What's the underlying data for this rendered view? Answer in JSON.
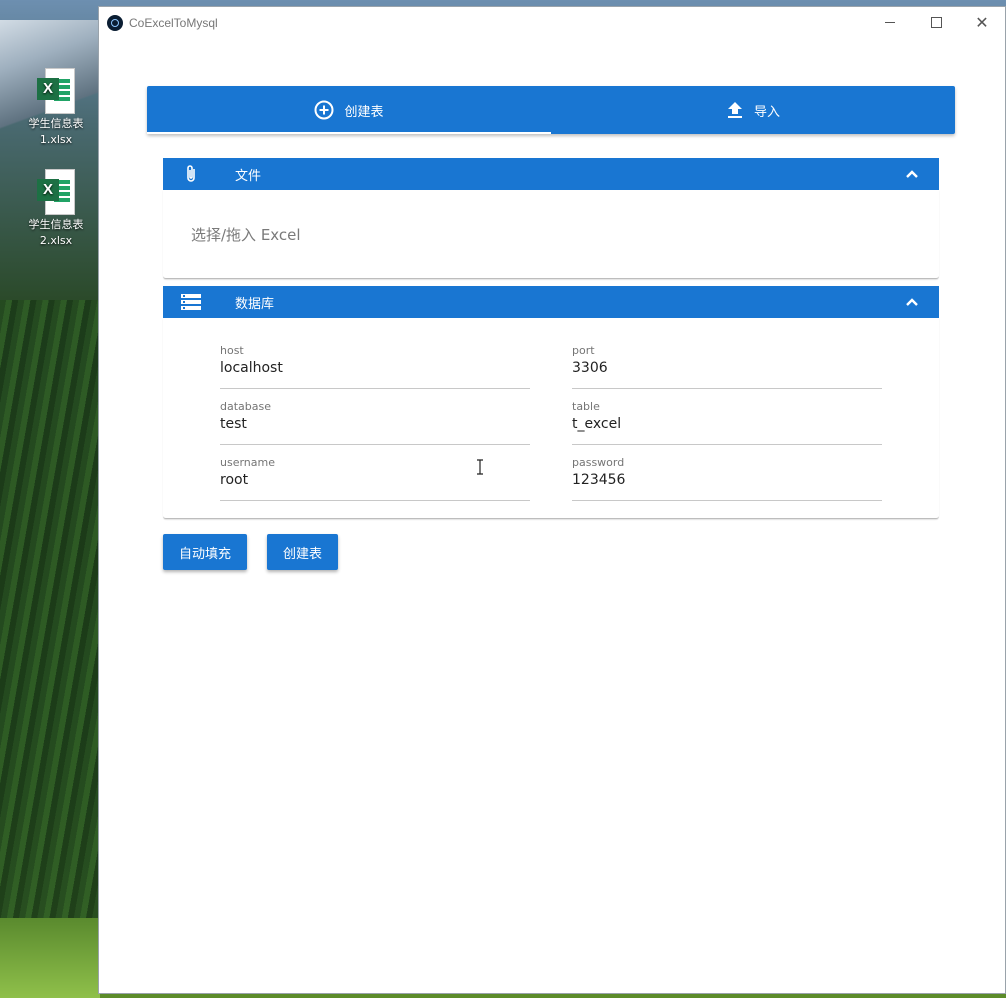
{
  "desktop": {
    "icons": [
      {
        "name": "学生信息表1.xlsx",
        "line1": "学生信息表",
        "line2": "1.xlsx"
      },
      {
        "name": "学生信息表2.xlsx",
        "line1": "学生信息表",
        "line2": "2.xlsx"
      }
    ],
    "excel_badge": "X"
  },
  "window": {
    "title": "CoExcelToMysql",
    "controls": {
      "minimize": "minimize",
      "maximize": "maximize",
      "close": "✕"
    }
  },
  "tabs": [
    {
      "label": "创建表",
      "icon": "add-circle-icon",
      "active": true
    },
    {
      "label": "导入",
      "icon": "upload-icon",
      "active": false
    }
  ],
  "file_panel": {
    "title": "文件",
    "icon": "paperclip-icon",
    "dropzone": "选择/拖入 Excel"
  },
  "db_panel": {
    "title": "数据库",
    "icon": "storage-icon",
    "fields": {
      "host": {
        "label": "host",
        "value": "localhost"
      },
      "port": {
        "label": "port",
        "value": "3306"
      },
      "database": {
        "label": "database",
        "value": "test"
      },
      "table": {
        "label": "table",
        "value": "t_excel"
      },
      "username": {
        "label": "username",
        "value": "root"
      },
      "password": {
        "label": "password",
        "value": "123456"
      }
    }
  },
  "actions": {
    "autofill": "自动填充",
    "create_table": "创建表"
  },
  "colors": {
    "primary": "#1976d2",
    "window_bg": "#ffffff"
  }
}
